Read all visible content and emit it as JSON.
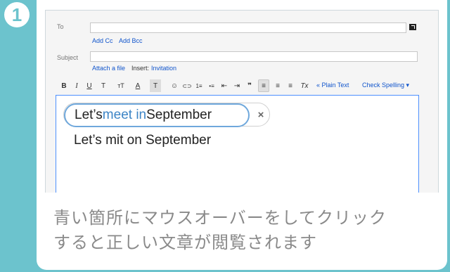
{
  "step": {
    "number": "1"
  },
  "compose": {
    "to_label": "To",
    "add_cc": "Add Cc",
    "add_bcc": "Add Bcc",
    "subject_label": "Subject",
    "attach_file": "Attach a file",
    "insert_label": "Insert:",
    "invitation": "Invitation"
  },
  "toolbar": {
    "items": [
      "B",
      "I",
      "U",
      "T",
      "тT",
      "A",
      "T",
      "☺",
      "⊂⊃",
      "1≡",
      "•≡",
      "⇤",
      "⇥",
      "❞",
      "≡",
      "≡",
      "≡",
      "Tx"
    ],
    "plain_text": "« Plain Text",
    "check_spelling": "Check Spelling ▾"
  },
  "suggestion": {
    "prefix": "Let’s ",
    "highlight": "meet in",
    "suffix": " September",
    "dismiss": "×"
  },
  "original_text": "Let’s mit on September",
  "instructions": {
    "line1": "青い箇所にマウスオーバーをしてクリック",
    "line2": "すると正しい文章が閲覧されます"
  },
  "colors": {
    "background": "#6cc3cd",
    "link": "#1155cc",
    "highlight": "#3d85c6",
    "focus_border": "#4d90fe"
  }
}
